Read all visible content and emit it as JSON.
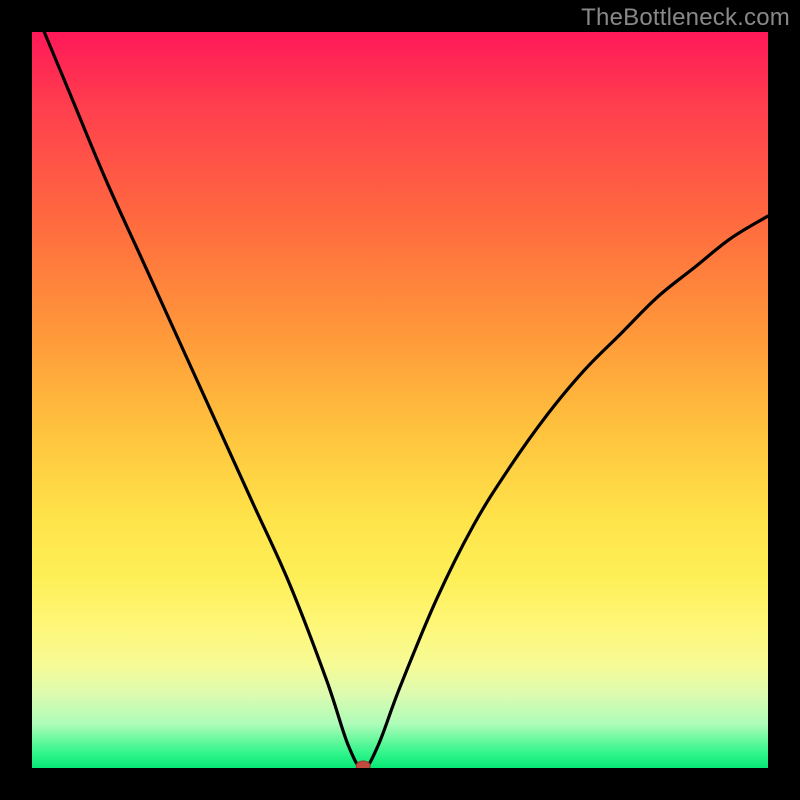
{
  "watermark": "TheBottleneck.com",
  "colors": {
    "frame": "#000000",
    "gradient_top": "#ff1858",
    "gradient_mid": "#ffe34a",
    "gradient_bottom": "#07e876",
    "curve": "#000000",
    "marker_fill": "#c24a3f",
    "marker_stroke": "#9a3a31"
  },
  "chart_data": {
    "type": "line",
    "title": "",
    "xlabel": "",
    "ylabel": "",
    "xlim": [
      0,
      100
    ],
    "ylim": [
      0,
      100
    ],
    "series": [
      {
        "name": "bottleneck-curve",
        "x": [
          0,
          5,
          10,
          15,
          20,
          25,
          30,
          35,
          40,
          43,
          45,
          47,
          50,
          55,
          60,
          65,
          70,
          75,
          80,
          85,
          90,
          95,
          100
        ],
        "y": [
          104,
          92,
          80,
          69,
          58,
          47,
          36,
          25,
          12,
          3,
          0,
          3,
          11,
          23,
          33,
          41,
          48,
          54,
          59,
          64,
          68,
          72,
          75
        ]
      }
    ],
    "annotations": [
      {
        "name": "min-marker",
        "x": 45,
        "y": 0
      }
    ]
  }
}
